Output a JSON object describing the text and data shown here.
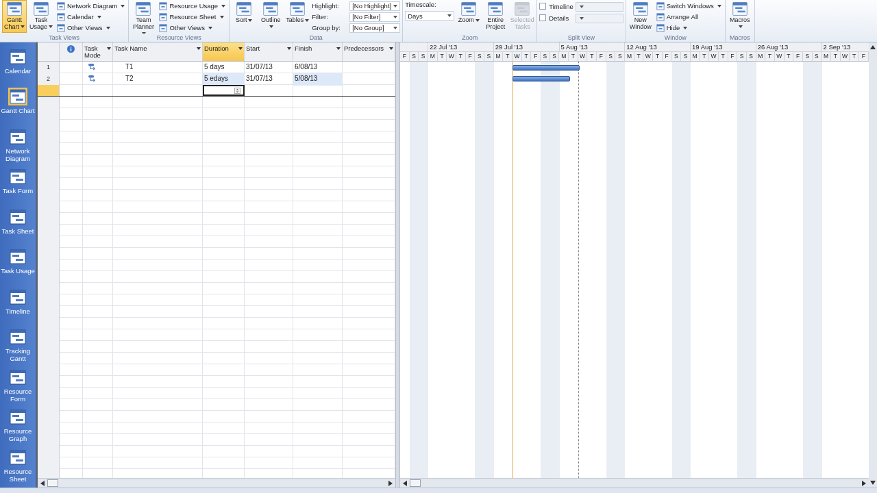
{
  "ribbon": {
    "groups": [
      {
        "label": "Task Views",
        "columns": [
          {
            "kind": "large",
            "items": [
              {
                "label": "Gantt Chart",
                "dropdown": true,
                "selected": true
              }
            ]
          },
          {
            "kind": "large",
            "items": [
              {
                "label": "Task Usage",
                "dropdown": true,
                "selected": false
              }
            ]
          },
          {
            "kind": "smalls",
            "items": [
              {
                "label": "Network Diagram",
                "dropdown": true
              },
              {
                "label": "Calendar",
                "dropdown": true
              },
              {
                "label": "Other Views",
                "dropdown": true
              }
            ]
          }
        ]
      },
      {
        "label": "Resource Views",
        "columns": [
          {
            "kind": "large",
            "items": [
              {
                "label": "Team Planner",
                "dropdown": true,
                "selected": false
              }
            ]
          },
          {
            "kind": "smalls",
            "items": [
              {
                "label": "Resource Usage",
                "dropdown": true
              },
              {
                "label": "Resource Sheet",
                "dropdown": true
              },
              {
                "label": "Other Views",
                "dropdown": true
              }
            ]
          }
        ]
      },
      {
        "label": "Data",
        "columns": [
          {
            "kind": "large",
            "items": [
              {
                "label": "Sort",
                "dropdown": true,
                "selected": false
              }
            ]
          },
          {
            "kind": "large",
            "items": [
              {
                "label": "Outline",
                "dropdown": true,
                "selected": false
              }
            ]
          },
          {
            "kind": "large",
            "items": [
              {
                "label": "Tables",
                "dropdown": true,
                "selected": false
              }
            ]
          },
          {
            "kind": "combos",
            "items": [
              {
                "label": "Highlight:",
                "value": "[No Highlight]"
              },
              {
                "label": "Filter:",
                "value": "[No Filter]"
              },
              {
                "label": "Group by:",
                "value": "[No Group]"
              }
            ]
          }
        ]
      },
      {
        "label": "Zoom",
        "columns": [
          {
            "kind": "timescale",
            "items": [
              {
                "label": "Timescale:",
                "value": "Days"
              }
            ]
          },
          {
            "kind": "large",
            "items": [
              {
                "label": "Zoom",
                "dropdown": true,
                "selected": false
              }
            ]
          },
          {
            "kind": "large",
            "items": [
              {
                "label": "Entire Project",
                "dropdown": false,
                "selected": false
              }
            ]
          },
          {
            "kind": "large",
            "items": [
              {
                "label": "Selected Tasks",
                "dropdown": false,
                "selected": false,
                "disabled": true
              }
            ]
          }
        ]
      },
      {
        "label": "Split View",
        "columns": [
          {
            "kind": "checks",
            "items": [
              {
                "label": "Timeline",
                "checked": false
              },
              {
                "label": "Details",
                "checked": false
              }
            ]
          },
          {
            "kind": "emptycombos",
            "items": [
              {
                "disabled": true
              },
              {
                "disabled": true
              }
            ]
          }
        ]
      },
      {
        "label": "Window",
        "columns": [
          {
            "kind": "large",
            "items": [
              {
                "label": "New Window",
                "dropdown": false,
                "selected": false
              }
            ]
          },
          {
            "kind": "smalls",
            "items": [
              {
                "label": "Switch Windows",
                "dropdown": true
              },
              {
                "label": "Arrange All",
                "dropdown": false
              },
              {
                "label": "Hide",
                "dropdown": true
              }
            ]
          }
        ]
      },
      {
        "label": "Macros",
        "columns": [
          {
            "kind": "large",
            "items": [
              {
                "label": "Macros",
                "dropdown": true,
                "selected": false
              }
            ]
          }
        ]
      }
    ]
  },
  "view_bar": {
    "items": [
      {
        "label": "Calendar",
        "selected": false
      },
      {
        "label": "Gantt Chart",
        "selected": true
      },
      {
        "label": "Network Diagram",
        "selected": false
      },
      {
        "label": "Task Form",
        "selected": false
      },
      {
        "label": "Task Sheet",
        "selected": false
      },
      {
        "label": "Task Usage",
        "selected": false
      },
      {
        "label": "Timeline",
        "selected": false
      },
      {
        "label": "Tracking Gantt",
        "selected": false
      },
      {
        "label": "Resource Form",
        "selected": false
      },
      {
        "label": "Resource Graph",
        "selected": false
      },
      {
        "label": "Resource Sheet",
        "selected": false
      }
    ]
  },
  "sheet": {
    "columns": [
      {
        "kind": "rownum",
        "selected": false
      },
      {
        "kind": "indicator",
        "selected": false
      },
      {
        "kind": "text",
        "label": "Task Mode",
        "selected": false
      },
      {
        "kind": "text",
        "label": "Task Name",
        "selected": false
      },
      {
        "kind": "text",
        "label": "Duration",
        "selected": true
      },
      {
        "kind": "text",
        "label": "Start",
        "selected": false
      },
      {
        "kind": "text",
        "label": "Finish",
        "selected": false
      },
      {
        "kind": "text",
        "label": "Predecessors",
        "selected": false
      }
    ],
    "rows": [
      {
        "id": "1",
        "name": "T1",
        "duration": "5 days",
        "start": "31/07/13",
        "finish": "6/08/13",
        "changed": false
      },
      {
        "id": "2",
        "name": "T2",
        "duration": "5 edays",
        "start": "31/07/13",
        "finish": "5/08/13",
        "changed": true
      }
    ],
    "entry_row": {
      "active": true
    }
  },
  "gantt": {
    "weeks": [
      "22 Jul '13",
      "29 Jul '13",
      "5 Aug '13",
      "12 Aug '13",
      "19 Aug '13",
      "26 Aug '13",
      "2 Sep '13"
    ],
    "days": [
      "F",
      "S",
      "S",
      "M",
      "T",
      "W",
      "T",
      "F",
      "S",
      "S",
      "M",
      "T",
      "W",
      "T",
      "F",
      "S",
      "S",
      "M",
      "T",
      "W",
      "T",
      "F",
      "S",
      "S",
      "M",
      "T",
      "W",
      "T",
      "F",
      "S",
      "S",
      "M",
      "T",
      "W",
      "T",
      "F",
      "S",
      "S",
      "M",
      "T",
      "W",
      "T",
      "F",
      "S",
      "S",
      "M",
      "T",
      "W",
      "T",
      "F"
    ]
  }
}
